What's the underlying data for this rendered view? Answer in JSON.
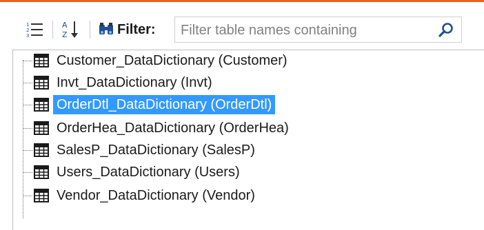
{
  "colors": {
    "accent": "#e8631f",
    "selection": "#3399ff",
    "selection_text": "#ffffff"
  },
  "toolbar": {
    "list_view_icon": "numbered-list-icon",
    "sort_icon": "sort-az-icon",
    "filter_icon": "binoculars-icon",
    "filter_label": "Filter:",
    "filter_placeholder": "Filter table names containing",
    "filter_value": "",
    "search_icon": "magnifier-icon"
  },
  "tree": {
    "item_icon": "table-icon",
    "items": [
      {
        "label": "Customer_DataDictionary (Customer)",
        "selected": false
      },
      {
        "label": "Invt_DataDictionary (Invt)",
        "selected": false
      },
      {
        "label": "OrderDtl_DataDictionary (OrderDtl)",
        "selected": true
      },
      {
        "label": "OrderHea_DataDictionary (OrderHea)",
        "selected": false
      },
      {
        "label": "SalesP_DataDictionary (SalesP)",
        "selected": false
      },
      {
        "label": "Users_DataDictionary (Users)",
        "selected": false
      },
      {
        "label": "Vendor_DataDictionary (Vendor)",
        "selected": false
      }
    ]
  }
}
